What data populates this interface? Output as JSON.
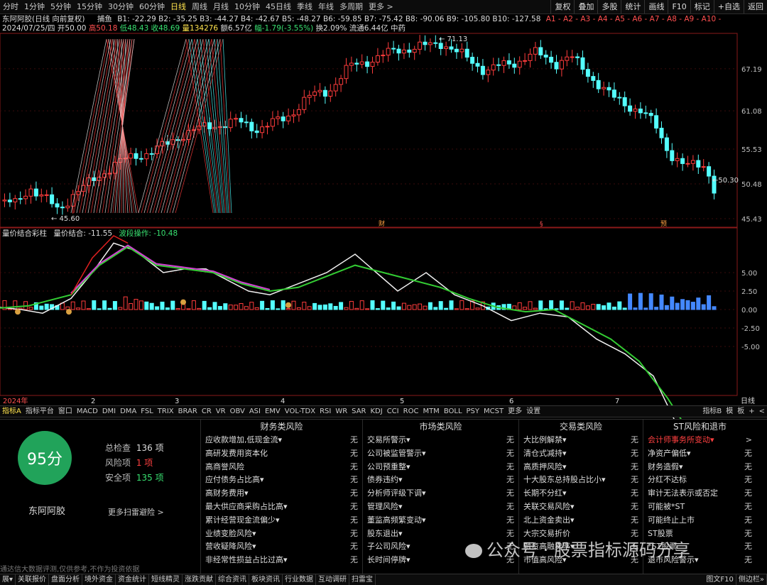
{
  "toolbar": {
    "tabs": [
      "分时",
      "1分钟",
      "5分钟",
      "15分钟",
      "30分钟",
      "60分钟",
      "日线",
      "周线",
      "月线",
      "10分钟",
      "45日线",
      "季线",
      "年线",
      "多周期",
      "更多 >"
    ],
    "active": "日线",
    "right": [
      "复权",
      "叠加",
      "多股",
      "统计",
      "画线",
      "F10",
      "标记",
      "+自选",
      "返回"
    ]
  },
  "info1": {
    "stock": "东阿阿胶(日线 向前复权)",
    "indicator": "捕鱼",
    "values": "B1: -22.29  B2: -35.25  B3: -44.27  B4: -42.67  B5: -48.27  B6: -59.85  B7: -75.42  B8: -90.06  B9: -105.80  B10: -127.58",
    "avalues": "A1 -  A2 -  A3 -  A4 -  A5 -  A6 -  A7 -  A8 -  A9 -  A10 -"
  },
  "info2": {
    "date": "2024/07/25/四",
    "open": "开50.00",
    "high": "高50.18",
    "low": "低48.43",
    "close": "收48.69",
    "vol": "量134276",
    "amt": "额6.57亿",
    "chg": "幅-1.79(-3.55%)",
    "turn": "换2.09%",
    "flow": "流通6.44亿",
    "sector": "中药"
  },
  "main_chart": {
    "price_labels": [
      "67.19",
      "61.08",
      "55.53",
      "50.48",
      "45.43"
    ],
    "max_label": "71.13",
    "min_label": "45.60",
    "last_label": "50.30",
    "markers": [
      "财",
      "§",
      "预"
    ]
  },
  "sub_chart": {
    "title": "量价结合彩柱",
    "v1": "量价结合: -11.55",
    "v2": "波段操作: -10.48",
    "y_labels": [
      "5.00",
      "2.50",
      "0.00",
      "-2.50",
      "-5.00"
    ]
  },
  "x_axis": {
    "labels": [
      "2024年",
      "2",
      "3",
      "4",
      "5",
      "6",
      "7"
    ],
    "period": "日线"
  },
  "indicator_tabs": [
    "指标A",
    "指标平台",
    "窗口",
    "MACD",
    "DMI",
    "DMA",
    "FSL",
    "TRIX",
    "BRAR",
    "CR",
    "VR",
    "OBV",
    "ASI",
    "EMV",
    "VOL-TDX",
    "RSI",
    "WR",
    "SAR",
    "KDJ",
    "CCI",
    "ROC",
    "MTM",
    "BOLL",
    "PSY",
    "MCST",
    "更多",
    "设置"
  ],
  "indicator_right": [
    "指标B",
    "模",
    "板",
    "+",
    "<"
  ],
  "risk": {
    "score": "95分",
    "name": "东阿阿胶",
    "total_label": "总检查",
    "total": "136 项",
    "risk_label": "风险项",
    "risk_count": "1 项",
    "safe_label": "安全项",
    "safe_count": "135 项",
    "more": "更多扫雷避险 >",
    "footer": "通达信大数据评测,仅供参考,不作为投资依据"
  },
  "risk_columns": [
    {
      "title": "财务类风险",
      "items": [
        "应收款增加,低现金流▾",
        "高研发费用资本化",
        "高商誉风险",
        "应付债务占比高▾",
        "高财务费用▾",
        "最大供应商采购占比高▾",
        "累计经营现金流偏少▾",
        "业绩变脸风险▾",
        "营收疑降风险▾",
        "非经常性损益占比过高▾"
      ]
    },
    {
      "title": "市场类风险",
      "items": [
        "交易所警示▾",
        "公司被监管警示▾",
        "公司预重整▾",
        "债券违约▾",
        "分析师评级下调▾",
        "管理风险▾",
        "董监高频繁变动▾",
        "股东退出▾",
        "子公司风险▾",
        "长时间停牌▾"
      ]
    },
    {
      "title": "交易类风险",
      "items": [
        "大比例解禁▾",
        "清仓式减持▾",
        "高质押风险▾",
        "十大股东总持股占比小▾",
        "长期不分红▾",
        "关联交易风险▾",
        "北上资金卖出▾",
        "大宗交易折价",
        "融资高融卖率▾",
        "市值高风险▾"
      ]
    },
    {
      "title": "ST风险和退市",
      "items": [
        "会计师事务所变动▾",
        "净资产偏低▾",
        "财务造假▾",
        "分红不达标",
        "审计无法表示或否定",
        "可能被*ST",
        "可能终止上市",
        "ST股票",
        "*ST股票",
        "退市风险警示▾"
      ]
    }
  ],
  "risk_value": "无",
  "watermark": "公众号 · 股票指标源码分享",
  "bottom_tabs": [
    "展▾",
    "关联报价",
    "盘面分析",
    "境外资金",
    "资金统计",
    "短线精灵",
    "涨跌贡献",
    "综合资讯",
    "板块资讯",
    "行业数据",
    "互动调研",
    "扫雷宝"
  ],
  "bottom_right": [
    "图文F10",
    "侧边栏»"
  ],
  "colors": {
    "up": "#ff3c3c",
    "down": "#54ffff",
    "yellow": "#ffe34d",
    "green": "#21a35a"
  }
}
